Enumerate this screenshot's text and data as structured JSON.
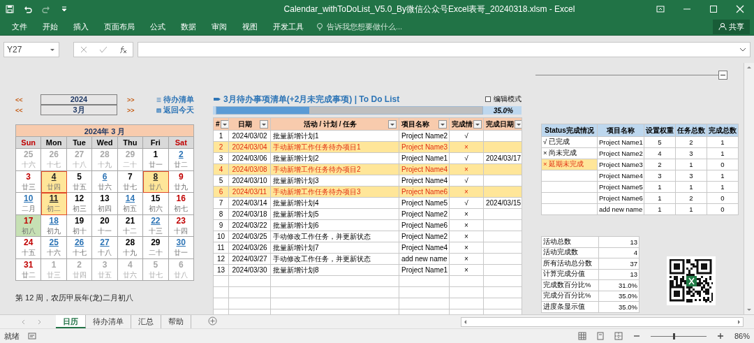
{
  "window": {
    "title": "Calendar_withToDoList_V5.0_By微信公众号Excel表哥_20240318.xlsm - Excel"
  },
  "ribbon": {
    "tabs": [
      "文件",
      "开始",
      "插入",
      "页面布局",
      "公式",
      "数据",
      "审阅",
      "视图",
      "开发工具"
    ],
    "tell_me": {
      "placeholder": "告诉我您想要做什么..."
    },
    "share": "共享"
  },
  "formula_bar": {
    "name_box": "Y27"
  },
  "calendar": {
    "year": "2024",
    "month": "3月",
    "prev": "<<",
    "next": ">>",
    "links": [
      {
        "kind": "list",
        "label": "待办清单"
      },
      {
        "kind": "today",
        "label": "返回今天"
      }
    ],
    "header": "2024年 3 月",
    "weekdays": [
      "Sun",
      "Mon",
      "Tue",
      "Wed",
      "Thu",
      "Fri",
      "Sat"
    ],
    "days": [
      {
        "day": "25",
        "lunar": "十六",
        "in_month": false,
        "has_task": false,
        "overdue": false,
        "today": false
      },
      {
        "day": "26",
        "lunar": "十七",
        "in_month": false,
        "has_task": false,
        "overdue": false,
        "today": false
      },
      {
        "day": "27",
        "lunar": "十八",
        "in_month": false,
        "has_task": false,
        "overdue": false,
        "today": false
      },
      {
        "day": "28",
        "lunar": "十九",
        "in_month": false,
        "has_task": false,
        "overdue": false,
        "today": false
      },
      {
        "day": "29",
        "lunar": "二十",
        "in_month": false,
        "has_task": false,
        "overdue": false,
        "today": false
      },
      {
        "day": "1",
        "lunar": "廿一",
        "in_month": true,
        "has_task": false,
        "overdue": false,
        "today": false
      },
      {
        "day": "2",
        "lunar": "廿二",
        "in_month": true,
        "has_task": true,
        "overdue": false,
        "today": false
      },
      {
        "day": "3",
        "lunar": "廿三",
        "in_month": true,
        "has_task": false,
        "overdue": false,
        "today": false
      },
      {
        "day": "4",
        "lunar": "廿四",
        "in_month": true,
        "has_task": true,
        "overdue": true,
        "today": false
      },
      {
        "day": "5",
        "lunar": "廿五",
        "in_month": true,
        "has_task": false,
        "overdue": false,
        "today": false
      },
      {
        "day": "6",
        "lunar": "廿六",
        "in_month": true,
        "has_task": true,
        "overdue": false,
        "today": false
      },
      {
        "day": "7",
        "lunar": "廿七",
        "in_month": true,
        "has_task": false,
        "overdue": false,
        "today": false
      },
      {
        "day": "8",
        "lunar": "廿八",
        "in_month": true,
        "has_task": true,
        "overdue": true,
        "today": false
      },
      {
        "day": "9",
        "lunar": "廿九",
        "in_month": true,
        "has_task": false,
        "overdue": false,
        "today": false
      },
      {
        "day": "10",
        "lunar": "二月",
        "in_month": true,
        "has_task": true,
        "overdue": false,
        "today": false
      },
      {
        "day": "11",
        "lunar": "初二",
        "in_month": true,
        "has_task": true,
        "overdue": true,
        "today": false
      },
      {
        "day": "12",
        "lunar": "初三",
        "in_month": true,
        "has_task": false,
        "overdue": false,
        "today": false
      },
      {
        "day": "13",
        "lunar": "初四",
        "in_month": true,
        "has_task": false,
        "overdue": false,
        "today": false
      },
      {
        "day": "14",
        "lunar": "初五",
        "in_month": true,
        "has_task": true,
        "overdue": false,
        "today": false
      },
      {
        "day": "15",
        "lunar": "初六",
        "in_month": true,
        "has_task": false,
        "overdue": false,
        "today": false
      },
      {
        "day": "16",
        "lunar": "初七",
        "in_month": true,
        "has_task": false,
        "overdue": false,
        "today": false
      },
      {
        "day": "17",
        "lunar": "初八",
        "in_month": true,
        "has_task": false,
        "overdue": false,
        "today": true
      },
      {
        "day": "18",
        "lunar": "初九",
        "in_month": true,
        "has_task": true,
        "overdue": false,
        "today": false
      },
      {
        "day": "19",
        "lunar": "初十",
        "in_month": true,
        "has_task": false,
        "overdue": false,
        "today": false
      },
      {
        "day": "20",
        "lunar": "十一",
        "in_month": true,
        "has_task": false,
        "overdue": false,
        "today": false
      },
      {
        "day": "21",
        "lunar": "十二",
        "in_month": true,
        "has_task": false,
        "overdue": false,
        "today": false
      },
      {
        "day": "22",
        "lunar": "十三",
        "in_month": true,
        "has_task": true,
        "overdue": false,
        "today": false
      },
      {
        "day": "23",
        "lunar": "十四",
        "in_month": true,
        "has_task": false,
        "overdue": false,
        "today": false
      },
      {
        "day": "24",
        "lunar": "十五",
        "in_month": true,
        "has_task": false,
        "overdue": false,
        "today": false
      },
      {
        "day": "25",
        "lunar": "十六",
        "in_month": true,
        "has_task": true,
        "overdue": false,
        "today": false
      },
      {
        "day": "26",
        "lunar": "十七",
        "in_month": true,
        "has_task": true,
        "overdue": false,
        "today": false
      },
      {
        "day": "27",
        "lunar": "十八",
        "in_month": true,
        "has_task": true,
        "overdue": false,
        "today": false
      },
      {
        "day": "28",
        "lunar": "十九",
        "in_month": true,
        "has_task": false,
        "overdue": false,
        "today": false
      },
      {
        "day": "29",
        "lunar": "二十",
        "in_month": true,
        "has_task": false,
        "overdue": false,
        "today": false
      },
      {
        "day": "30",
        "lunar": "廿一",
        "in_month": true,
        "has_task": true,
        "overdue": false,
        "today": false
      },
      {
        "day": "31",
        "lunar": "廿二",
        "in_month": true,
        "has_task": false,
        "overdue": false,
        "today": false
      },
      {
        "day": "1",
        "lunar": "廿三",
        "in_month": false,
        "has_task": false,
        "overdue": false,
        "today": false
      },
      {
        "day": "2",
        "lunar": "廿四",
        "in_month": false,
        "has_task": false,
        "overdue": false,
        "today": false
      },
      {
        "day": "3",
        "lunar": "廿五",
        "in_month": false,
        "has_task": false,
        "overdue": false,
        "today": false
      },
      {
        "day": "4",
        "lunar": "廿六",
        "in_month": false,
        "has_task": false,
        "overdue": false,
        "today": false
      },
      {
        "day": "5",
        "lunar": "廿七",
        "in_month": false,
        "has_task": false,
        "overdue": false,
        "today": false
      },
      {
        "day": "6",
        "lunar": "廿八",
        "in_month": false,
        "has_task": false,
        "overdue": false,
        "today": false
      }
    ],
    "week_info": "第 12 周，农历甲辰年(龙)二月初八"
  },
  "todo": {
    "title": "3月待办事项清单(+2月未完成事项) | To Do List",
    "edit_mode": {
      "label": "编辑模式",
      "checked": false
    },
    "progress": {
      "level": 0.35,
      "reading": "35.0%"
    },
    "columns": [
      "#",
      "日期",
      "活动 / 计划 / 任务",
      "项目名称",
      "完成情",
      "完成日期"
    ],
    "rows": [
      {
        "num": "1",
        "date": "2024/03/02",
        "task": "批量新增计划1",
        "project": "Project Name2",
        "status": "√",
        "done_date": "",
        "overdue": false
      },
      {
        "num": "2",
        "date": "2024/03/04",
        "task": "手动新增工作任务待办项目1",
        "project": "Project Name3",
        "status": "×",
        "done_date": "",
        "overdue": true
      },
      {
        "num": "3",
        "date": "2024/03/06",
        "task": "批量新增计划2",
        "project": "Project Name1",
        "status": "√",
        "done_date": "2024/03/17",
        "overdue": false
      },
      {
        "num": "4",
        "date": "2024/03/08",
        "task": "手动新增工作任务待办项目2",
        "project": "Project Name4",
        "status": "×",
        "done_date": "",
        "overdue": true
      },
      {
        "num": "5",
        "date": "2024/03/10",
        "task": "批量新增计划3",
        "project": "Project Name4",
        "status": "√",
        "done_date": "",
        "overdue": false
      },
      {
        "num": "6",
        "date": "2024/03/11",
        "task": "手动新增工作任务待办项目3",
        "project": "Project Name6",
        "status": "×",
        "done_date": "",
        "overdue": true
      },
      {
        "num": "7",
        "date": "2024/03/14",
        "task": "批量新增计划4",
        "project": "Project Name5",
        "status": "√",
        "done_date": "2024/03/15",
        "overdue": false
      },
      {
        "num": "8",
        "date": "2024/03/18",
        "task": "批量新增计划5",
        "project": "Project Name2",
        "status": "×",
        "done_date": "",
        "overdue": false
      },
      {
        "num": "9",
        "date": "2024/03/22",
        "task": "批量新增计划6",
        "project": "Project Name6",
        "status": "×",
        "done_date": "",
        "overdue": false
      },
      {
        "num": "10",
        "date": "2024/03/25",
        "task": "手动修改工作任务，并更新状态",
        "project": "Project Name2",
        "status": "×",
        "done_date": "",
        "overdue": false
      },
      {
        "num": "11",
        "date": "2024/03/26",
        "task": "批量新增计划7",
        "project": "Project Name4",
        "status": "×",
        "done_date": "",
        "overdue": false
      },
      {
        "num": "12",
        "date": "2024/03/27",
        "task": "手动修改工作任务，并更新状态",
        "project": "add new name",
        "status": "×",
        "done_date": "",
        "overdue": false
      },
      {
        "num": "13",
        "date": "2024/03/30",
        "task": "批量新增计划8",
        "project": "Project Name1",
        "status": "×",
        "done_date": "",
        "overdue": false
      }
    ]
  },
  "status_table": {
    "columns": [
      "Status完成情况",
      "项目名称",
      "设置权重",
      "任务总数",
      "完成总数"
    ],
    "rows": [
      {
        "legend": "√ 已完成",
        "legend_highlight": false,
        "project": "Project Name1",
        "weight": "5",
        "tasks": "2",
        "done": "1"
      },
      {
        "legend": "× 尚未完成",
        "legend_highlight": false,
        "project": "Project Name2",
        "weight": "4",
        "tasks": "3",
        "done": "1"
      },
      {
        "legend": "× 延期未完成",
        "legend_highlight": true,
        "project": "Project Name3",
        "weight": "2",
        "tasks": "1",
        "done": "0"
      },
      {
        "legend": "",
        "legend_highlight": false,
        "project": "Project Name4",
        "weight": "3",
        "tasks": "3",
        "done": "1"
      },
      {
        "legend": "",
        "legend_highlight": false,
        "project": "Project Name5",
        "weight": "1",
        "tasks": "1",
        "done": "1"
      },
      {
        "legend": "",
        "legend_highlight": false,
        "project": "Project Name6",
        "weight": "1",
        "tasks": "2",
        "done": "0"
      },
      {
        "legend": "",
        "legend_highlight": false,
        "project": "add new name",
        "weight": "1",
        "tasks": "1",
        "done": "0"
      }
    ]
  },
  "stats": [
    {
      "label": "活动总数",
      "value": "13"
    },
    {
      "label": "活动完成数",
      "value": "4"
    },
    {
      "label": "所有活动总分数",
      "value": "37"
    },
    {
      "label": "计算完成分值",
      "value": "13"
    },
    {
      "label": "完成数百分比%",
      "value": "31.0%"
    },
    {
      "label": "完成分百分比%",
      "value": "35.0%"
    },
    {
      "label": "进度条显示值",
      "value": "35.0%"
    }
  ],
  "sheet_tabs": [
    {
      "label": "日历",
      "selected": true
    },
    {
      "label": "待办清单",
      "selected": false
    },
    {
      "label": "汇总",
      "selected": false
    },
    {
      "label": "帮助",
      "selected": false
    }
  ],
  "status_bar": {
    "text": "就绪",
    "zoom": {
      "level": 0.4,
      "reading": "86%"
    }
  }
}
